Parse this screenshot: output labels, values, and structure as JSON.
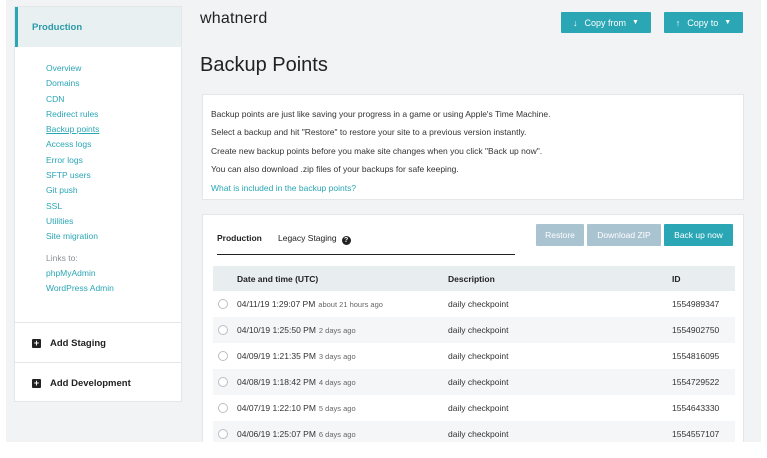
{
  "sidebar": {
    "section_title": "Production",
    "links": [
      "Overview",
      "Domains",
      "CDN",
      "Redirect rules",
      "Backup points",
      "Access logs",
      "Error logs",
      "SFTP users",
      "Git push",
      "SSL",
      "Utilities",
      "Site migration"
    ],
    "active_link": "Backup points",
    "links_to_label": "Links to:",
    "external_links": [
      "phpMyAdmin",
      "WordPress Admin"
    ],
    "add_staging": "Add Staging",
    "add_development": "Add Development"
  },
  "header": {
    "site_name": "whatnerd",
    "copy_from": "Copy from",
    "copy_to": "Copy to"
  },
  "page": {
    "title": "Backup Points"
  },
  "info": {
    "lines": [
      "Backup points are just like saving your progress in a game or using Apple's Time Machine.",
      "Select a backup and hit \"Restore\" to restore your site to a previous version instantly.",
      "Create new backup points before you make site changes when you click \"Back up now\".",
      "You can also download .zip files of your backups for safe keeping."
    ],
    "link": "What is included in the backup points?"
  },
  "tabs": [
    "Production",
    "Legacy Staging"
  ],
  "actions": {
    "restore": "Restore",
    "download": "Download ZIP",
    "backup": "Back up now"
  },
  "table": {
    "headers": [
      "Date and time (UTC)",
      "Description",
      "ID"
    ],
    "rows": [
      {
        "date": "04/11/19 1:29:07 PM",
        "relative": "about 21 hours ago",
        "description": "daily checkpoint",
        "id": "1554989347"
      },
      {
        "date": "04/10/19 1:25:50 PM",
        "relative": "2 days ago",
        "description": "daily checkpoint",
        "id": "1554902750"
      },
      {
        "date": "04/09/19 1:21:35 PM",
        "relative": "3 days ago",
        "description": "daily checkpoint",
        "id": "1554816095"
      },
      {
        "date": "04/08/19 1:18:42 PM",
        "relative": "4 days ago",
        "description": "daily checkpoint",
        "id": "1554729522"
      },
      {
        "date": "04/07/19 1:22:10 PM",
        "relative": "5 days ago",
        "description": "daily checkpoint",
        "id": "1554643330"
      },
      {
        "date": "04/06/19 1:25:07 PM",
        "relative": "6 days ago",
        "description": "daily checkpoint",
        "id": "1554557107"
      }
    ]
  },
  "colors": {
    "accent": "#2aa6b5",
    "disabled_button": "#a9c3d1",
    "background": "#f1f3f4"
  }
}
